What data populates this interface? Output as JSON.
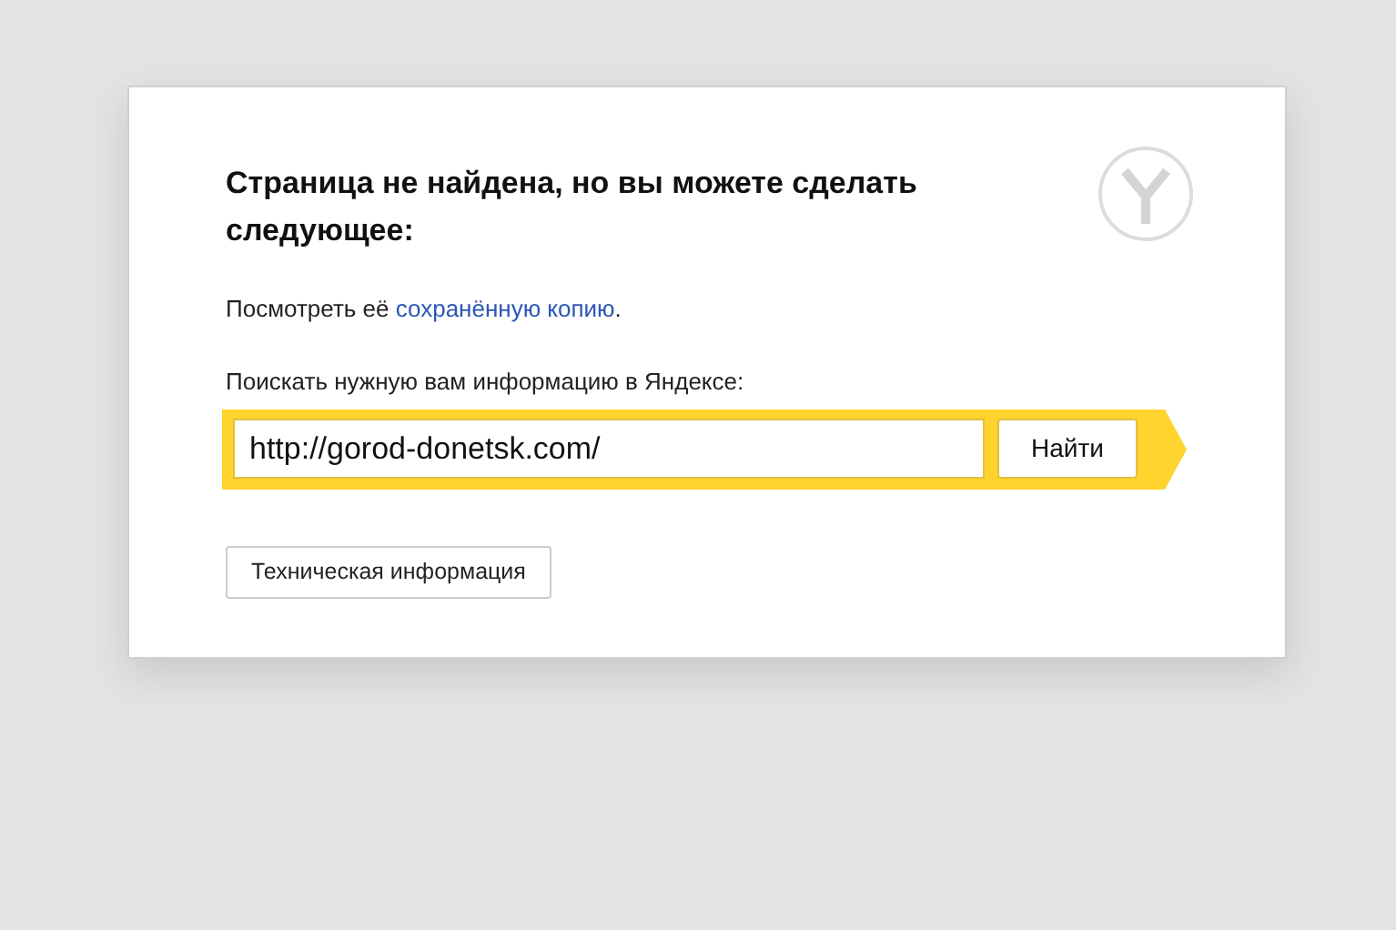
{
  "title": "Страница не найдена, но вы можете сделать следующее:",
  "cached_copy": {
    "prefix": "Посмотреть её ",
    "link": "сохранённую копию",
    "suffix": "."
  },
  "search": {
    "label": "Поискать нужную вам информацию в Яндексе:",
    "value": "http://gorod-donetsk.com/",
    "button": "Найти"
  },
  "tech_button": "Техническая информация"
}
